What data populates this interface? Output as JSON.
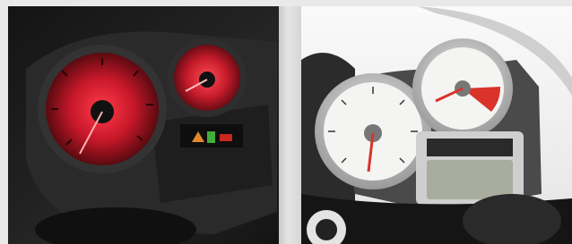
{
  "photos": [
    {
      "id": "night",
      "illumination_color": "#d41c2c",
      "indicators": [
        {
          "icon": "triangle-warning-icon",
          "color": "#e0892a"
        },
        {
          "icon": "green-lamp-icon",
          "color": "#3fae3a"
        },
        {
          "icon": "abs-lamp-icon",
          "color": "#c8281e"
        }
      ]
    },
    {
      "id": "day",
      "dial_color": "#f4f4f2",
      "redline_color": "#d9332a",
      "bezel_color": "#cfcfcf"
    }
  ]
}
